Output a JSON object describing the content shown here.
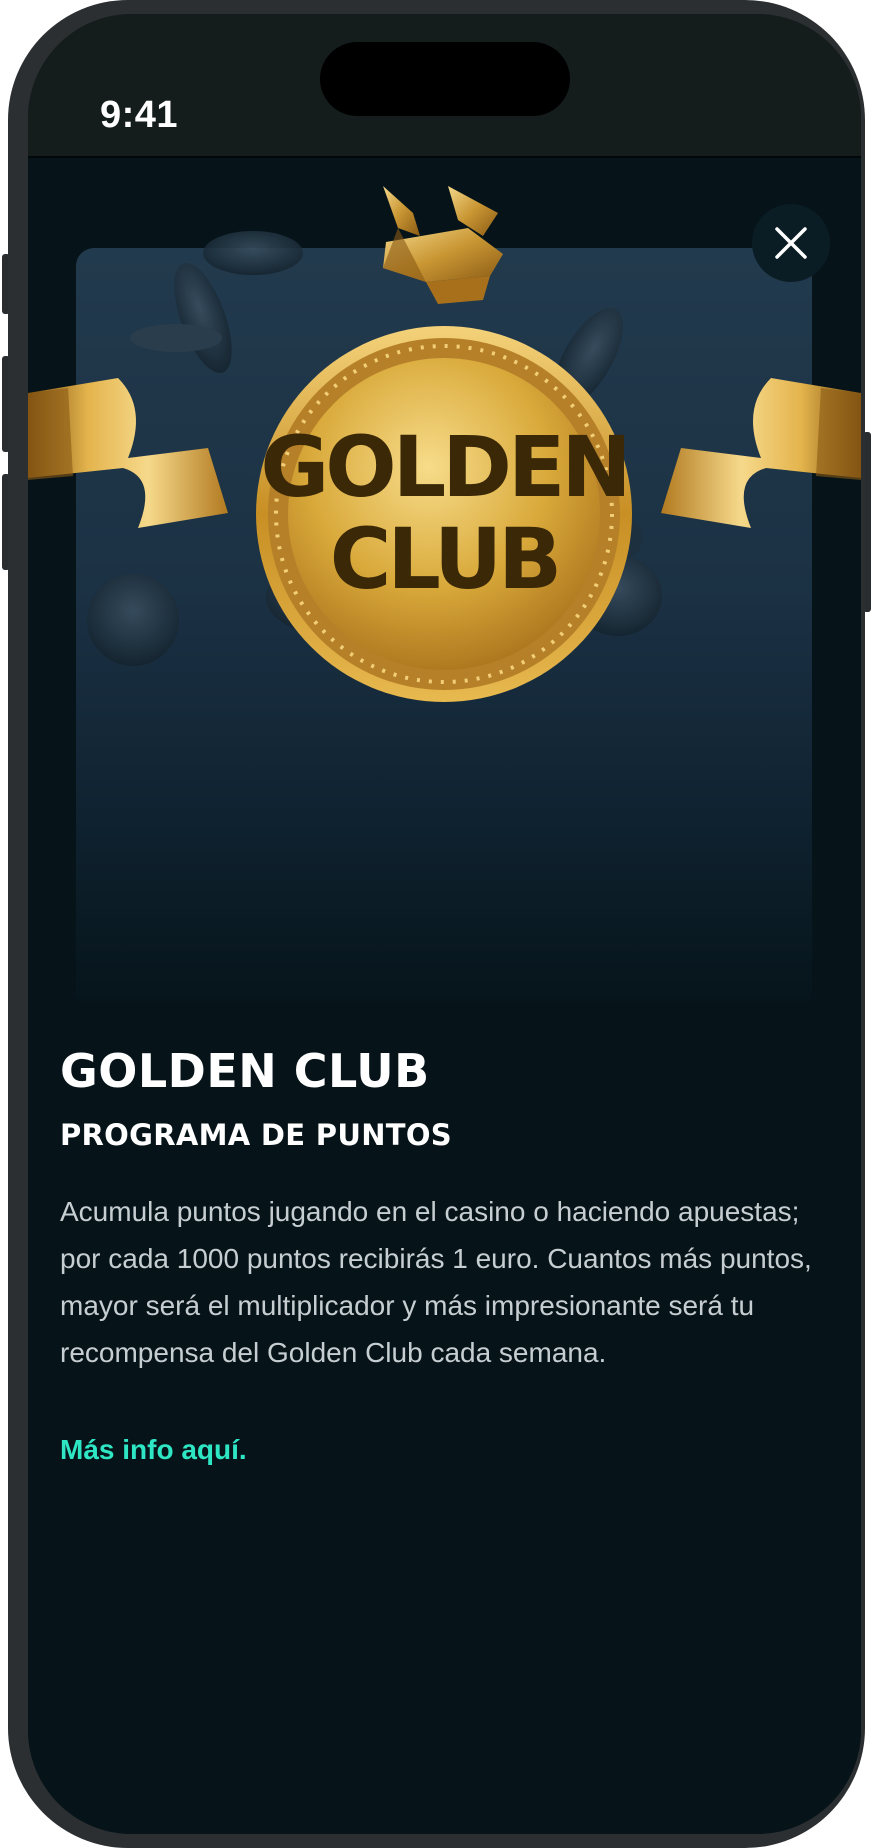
{
  "status_bar": {
    "time": "9:41"
  },
  "hero": {
    "badge_line1": "GOLDEN",
    "badge_line2": "CLUB",
    "icons": [
      "bull-emblem-icon",
      "ribbon-icon",
      "casino-chip-icon"
    ]
  },
  "close": {
    "icon": "close-icon"
  },
  "content": {
    "title": "GOLDEN CLUB",
    "subtitle": "PROGRAMA DE PUNTOS",
    "description": "Acumula puntos jugando en el casino o haciendo apuestas; por cada 1000 puntos recibirás 1 euro. Cuantos más puntos, mayor será el multiplicador y más impresionante será tu recompensa del Golden Club cada semana.",
    "more_link": "Más info aquí."
  },
  "colors": {
    "background": "#06141a",
    "status_bar": "#151d1c",
    "accent_link": "#2ee6c4",
    "gold": "#d9a93a"
  }
}
